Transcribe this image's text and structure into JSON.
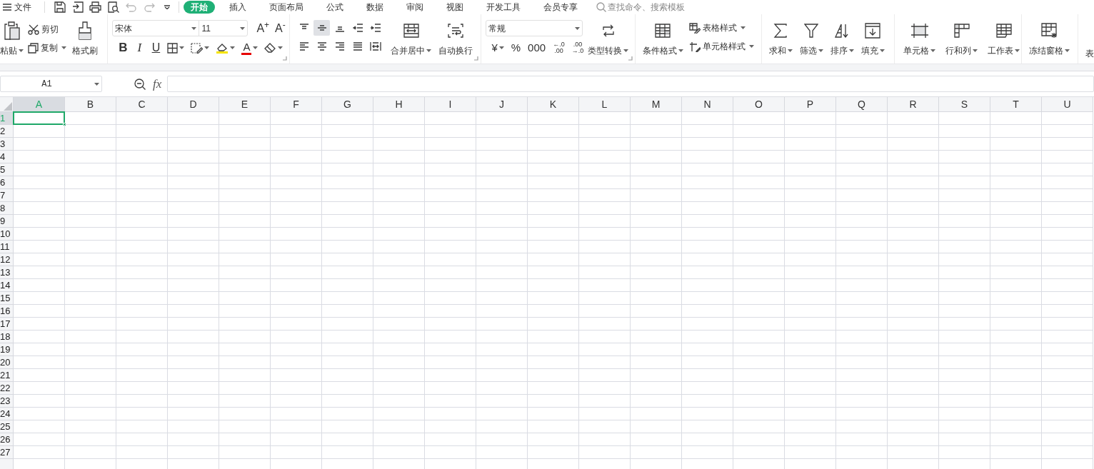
{
  "menu": {
    "file_label": "文件"
  },
  "tabs": [
    {
      "label": "开始",
      "selected": true
    },
    {
      "label": "插入",
      "selected": false
    },
    {
      "label": "页面布局",
      "selected": false
    },
    {
      "label": "公式",
      "selected": false
    },
    {
      "label": "数据",
      "selected": false
    },
    {
      "label": "审阅",
      "selected": false
    },
    {
      "label": "视图",
      "selected": false
    },
    {
      "label": "开发工具",
      "selected": false
    },
    {
      "label": "会员专享",
      "selected": false
    }
  ],
  "search": {
    "placeholder": "查找命令、搜索模板"
  },
  "ribbon": {
    "clipboard": {
      "paste": "粘贴",
      "cut": "剪切",
      "copy": "复制",
      "format_painter": "格式刷"
    },
    "font": {
      "font_name": "宋体",
      "font_size": "11",
      "grow_font": "A$^{+}$",
      "shrink_font": "A$^{-}$",
      "bold": "B",
      "italic": "I",
      "underline": "U",
      "font_color": "A"
    },
    "alignment": {
      "align_buttons": [
        {
          "kind": "top",
          "selected": false
        },
        {
          "kind": "middle",
          "selected": true
        },
        {
          "kind": "bottom",
          "selected": false
        },
        {
          "kind": "outdent",
          "selected": false
        },
        {
          "kind": "indent",
          "selected": false
        },
        {
          "kind": "left",
          "selected": false
        },
        {
          "kind": "center",
          "selected": false
        },
        {
          "kind": "right",
          "selected": false
        },
        {
          "kind": "justify",
          "selected": false
        },
        {
          "kind": "distributed",
          "selected": false
        }
      ],
      "merge": "合并居中",
      "wrap": "自动换行"
    },
    "number": {
      "format": "常规",
      "buttons": [
        {
          "kind": "currency",
          "lines": [
            "¥"
          ]
        },
        {
          "kind": "percent",
          "lines": [
            "%"
          ]
        },
        {
          "kind": "thousands",
          "lines": [
            "000"
          ]
        },
        {
          "kind": "decimal_increase",
          "lines": [
            "←.0",
            ".00"
          ]
        },
        {
          "kind": "decimal_decrease",
          "lines": [
            ".00",
            "→.0"
          ]
        }
      ],
      "convert": "类型转换"
    },
    "styles": {
      "conditional": "条件格式",
      "table_style": "表格样式",
      "cell_style": "单元格样式"
    },
    "editing": [
      {
        "kind": "sum",
        "label": "求和"
      },
      {
        "kind": "filter",
        "label": "筛选"
      },
      {
        "kind": "sort",
        "label": "排序"
      },
      {
        "kind": "fill",
        "label": "填充"
      }
    ],
    "cells": [
      {
        "kind": "cell",
        "label": "单元格"
      },
      {
        "kind": "rowcol",
        "label": "行和列"
      },
      {
        "kind": "sheet",
        "label": "工作表"
      }
    ],
    "freeze": "冻结窗格",
    "cut_off_label": "表"
  },
  "formula_bar": {
    "name_box": "A1",
    "function_label": "fx"
  },
  "sheet": {
    "columns": [
      {
        "label": "A",
        "selected": true
      },
      {
        "label": "B",
        "selected": false
      },
      {
        "label": "C",
        "selected": false
      },
      {
        "label": "D",
        "selected": false
      },
      {
        "label": "E",
        "selected": false
      },
      {
        "label": "F",
        "selected": false
      },
      {
        "label": "G",
        "selected": false
      },
      {
        "label": "H",
        "selected": false
      },
      {
        "label": "I",
        "selected": false
      },
      {
        "label": "J",
        "selected": false
      },
      {
        "label": "K",
        "selected": false
      },
      {
        "label": "L",
        "selected": false
      },
      {
        "label": "M",
        "selected": false
      },
      {
        "label": "N",
        "selected": false
      },
      {
        "label": "O",
        "selected": false
      },
      {
        "label": "P",
        "selected": false
      },
      {
        "label": "Q",
        "selected": false
      },
      {
        "label": "R",
        "selected": false
      },
      {
        "label": "S",
        "selected": false
      },
      {
        "label": "T",
        "selected": false
      },
      {
        "label": "U",
        "selected": false
      }
    ],
    "rows": [
      {
        "label": "1",
        "selected": true
      },
      {
        "label": "2",
        "selected": false
      },
      {
        "label": "3",
        "selected": false
      },
      {
        "label": "4",
        "selected": false
      },
      {
        "label": "5",
        "selected": false
      },
      {
        "label": "6",
        "selected": false
      },
      {
        "label": "7",
        "selected": false
      },
      {
        "label": "8",
        "selected": false
      },
      {
        "label": "9",
        "selected": false
      },
      {
        "label": "10",
        "selected": false
      },
      {
        "label": "11",
        "selected": false
      },
      {
        "label": "12",
        "selected": false
      },
      {
        "label": "13",
        "selected": false
      },
      {
        "label": "14",
        "selected": false
      },
      {
        "label": "15",
        "selected": false
      },
      {
        "label": "16",
        "selected": false
      },
      {
        "label": "17",
        "selected": false
      },
      {
        "label": "18",
        "selected": false
      },
      {
        "label": "19",
        "selected": false
      },
      {
        "label": "20",
        "selected": false
      },
      {
        "label": "21",
        "selected": false
      },
      {
        "label": "22",
        "selected": false
      },
      {
        "label": "23",
        "selected": false
      },
      {
        "label": "24",
        "selected": false
      },
      {
        "label": "25",
        "selected": false
      },
      {
        "label": "26",
        "selected": false
      },
      {
        "label": "27",
        "selected": false
      },
      {
        "selected": false
      }
    ]
  }
}
